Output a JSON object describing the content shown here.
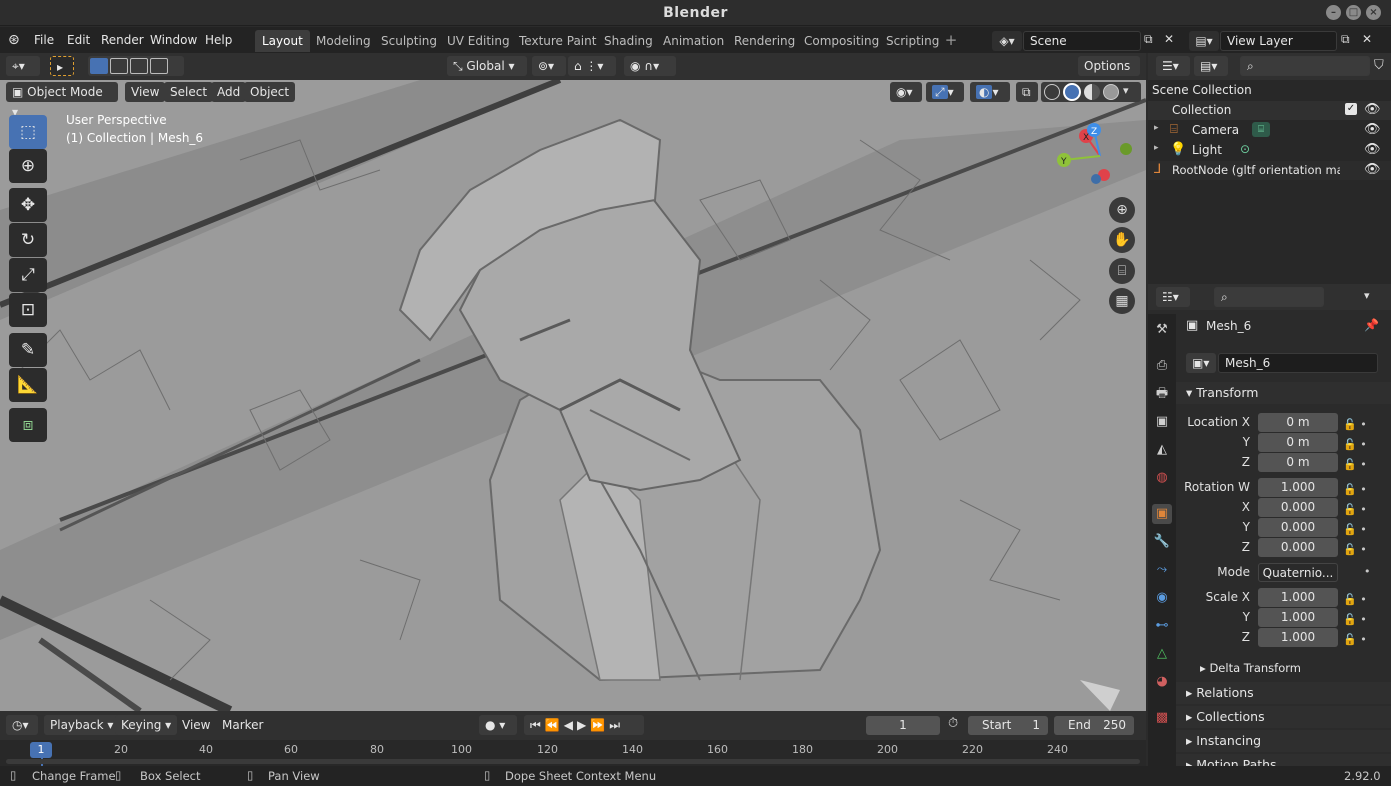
{
  "window": {
    "title": "Blender",
    "version": "2.92.0"
  },
  "menus": [
    "File",
    "Edit",
    "Render",
    "Window",
    "Help"
  ],
  "workspaces": [
    "Layout",
    "Modeling",
    "Sculpting",
    "UV Editing",
    "Texture Paint",
    "Shading",
    "Animation",
    "Rendering",
    "Compositing",
    "Scripting"
  ],
  "active_workspace": "Layout",
  "scene": {
    "name": "Scene",
    "view_layer": "View Layer"
  },
  "header": {
    "transform_orientation": "Global",
    "options": "Options"
  },
  "viewport": {
    "mode": "Object Mode",
    "menus": [
      "View",
      "Select",
      "Add",
      "Object"
    ],
    "perspective": "User Perspective",
    "context": "(1) Collection | Mesh_6",
    "gizmo": {
      "x": "X",
      "y": "Y",
      "z": "Z"
    }
  },
  "outliner": {
    "root": "Scene Collection",
    "collection": "Collection",
    "items": [
      {
        "name": "Camera",
        "icon": "camera-icon",
        "color": "#e0863a"
      },
      {
        "name": "Light",
        "icon": "light-icon",
        "color": "#e0863a"
      },
      {
        "name": "RootNode (gltf orientation matrix)",
        "icon": "empty-icon",
        "color": "#e0863a"
      }
    ]
  },
  "properties": {
    "object_name": "Mesh_6",
    "data_name": "Mesh_6",
    "transform_title": "Transform",
    "location": {
      "label": "Location X",
      "x": "0 m",
      "y": "0 m",
      "z": "0 m"
    },
    "rotation": {
      "label": "Rotation W",
      "w": "1.000",
      "x": "0.000",
      "y": "0.000",
      "z": "0.000"
    },
    "mode_label": "Mode",
    "mode_value": "Quaternio...",
    "scale": {
      "label": "Scale X",
      "x": "1.000",
      "y": "1.000",
      "z": "1.000"
    },
    "axis_labels": {
      "x": "X",
      "y": "Y",
      "z": "Z"
    },
    "delta": "Delta Transform",
    "panels": [
      "Relations",
      "Collections",
      "Instancing",
      "Motion Paths"
    ]
  },
  "timeline": {
    "menus": [
      "Playback",
      "Keying",
      "View",
      "Marker"
    ],
    "current_frame": "1",
    "start_label": "Start",
    "start": "1",
    "end_label": "End",
    "end": "250",
    "ticks": [
      "1",
      "20",
      "40",
      "60",
      "80",
      "100",
      "120",
      "140",
      "160",
      "180",
      "200",
      "220",
      "240"
    ]
  },
  "status": {
    "change_frame": "Change Frame",
    "box_select": "Box Select",
    "pan_view": "Pan View",
    "context_menu": "Dope Sheet Context Menu"
  },
  "colors": {
    "accent": "#4772b3",
    "axis_x": "#e0424a",
    "axis_y": "#8fc23a",
    "axis_z": "#3e8ee8",
    "object": "#e0863a"
  }
}
